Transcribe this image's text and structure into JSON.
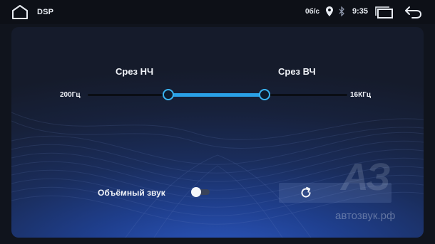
{
  "status_bar": {
    "app_title": "DSP",
    "speed": "0б/с",
    "time": "9:35",
    "icons": [
      "home-icon",
      "location-icon",
      "bluetooth-icon",
      "recent-apps-icon",
      "back-icon"
    ]
  },
  "crossover": {
    "low_cut_label": "Срез НЧ",
    "high_cut_label": "Срез ВЧ",
    "min_label": "200Гц",
    "max_label": "16КГц",
    "low_position": 0.31,
    "high_position": 0.68,
    "range_color": "#2aa0e6",
    "thumb_color": "#3ab4f2"
  },
  "surround": {
    "label": "Объёмный звук",
    "enabled": false
  },
  "reset": {
    "icon": "refresh-icon"
  },
  "watermark": {
    "mark": "АЗ",
    "site": "автозвук.рф"
  }
}
